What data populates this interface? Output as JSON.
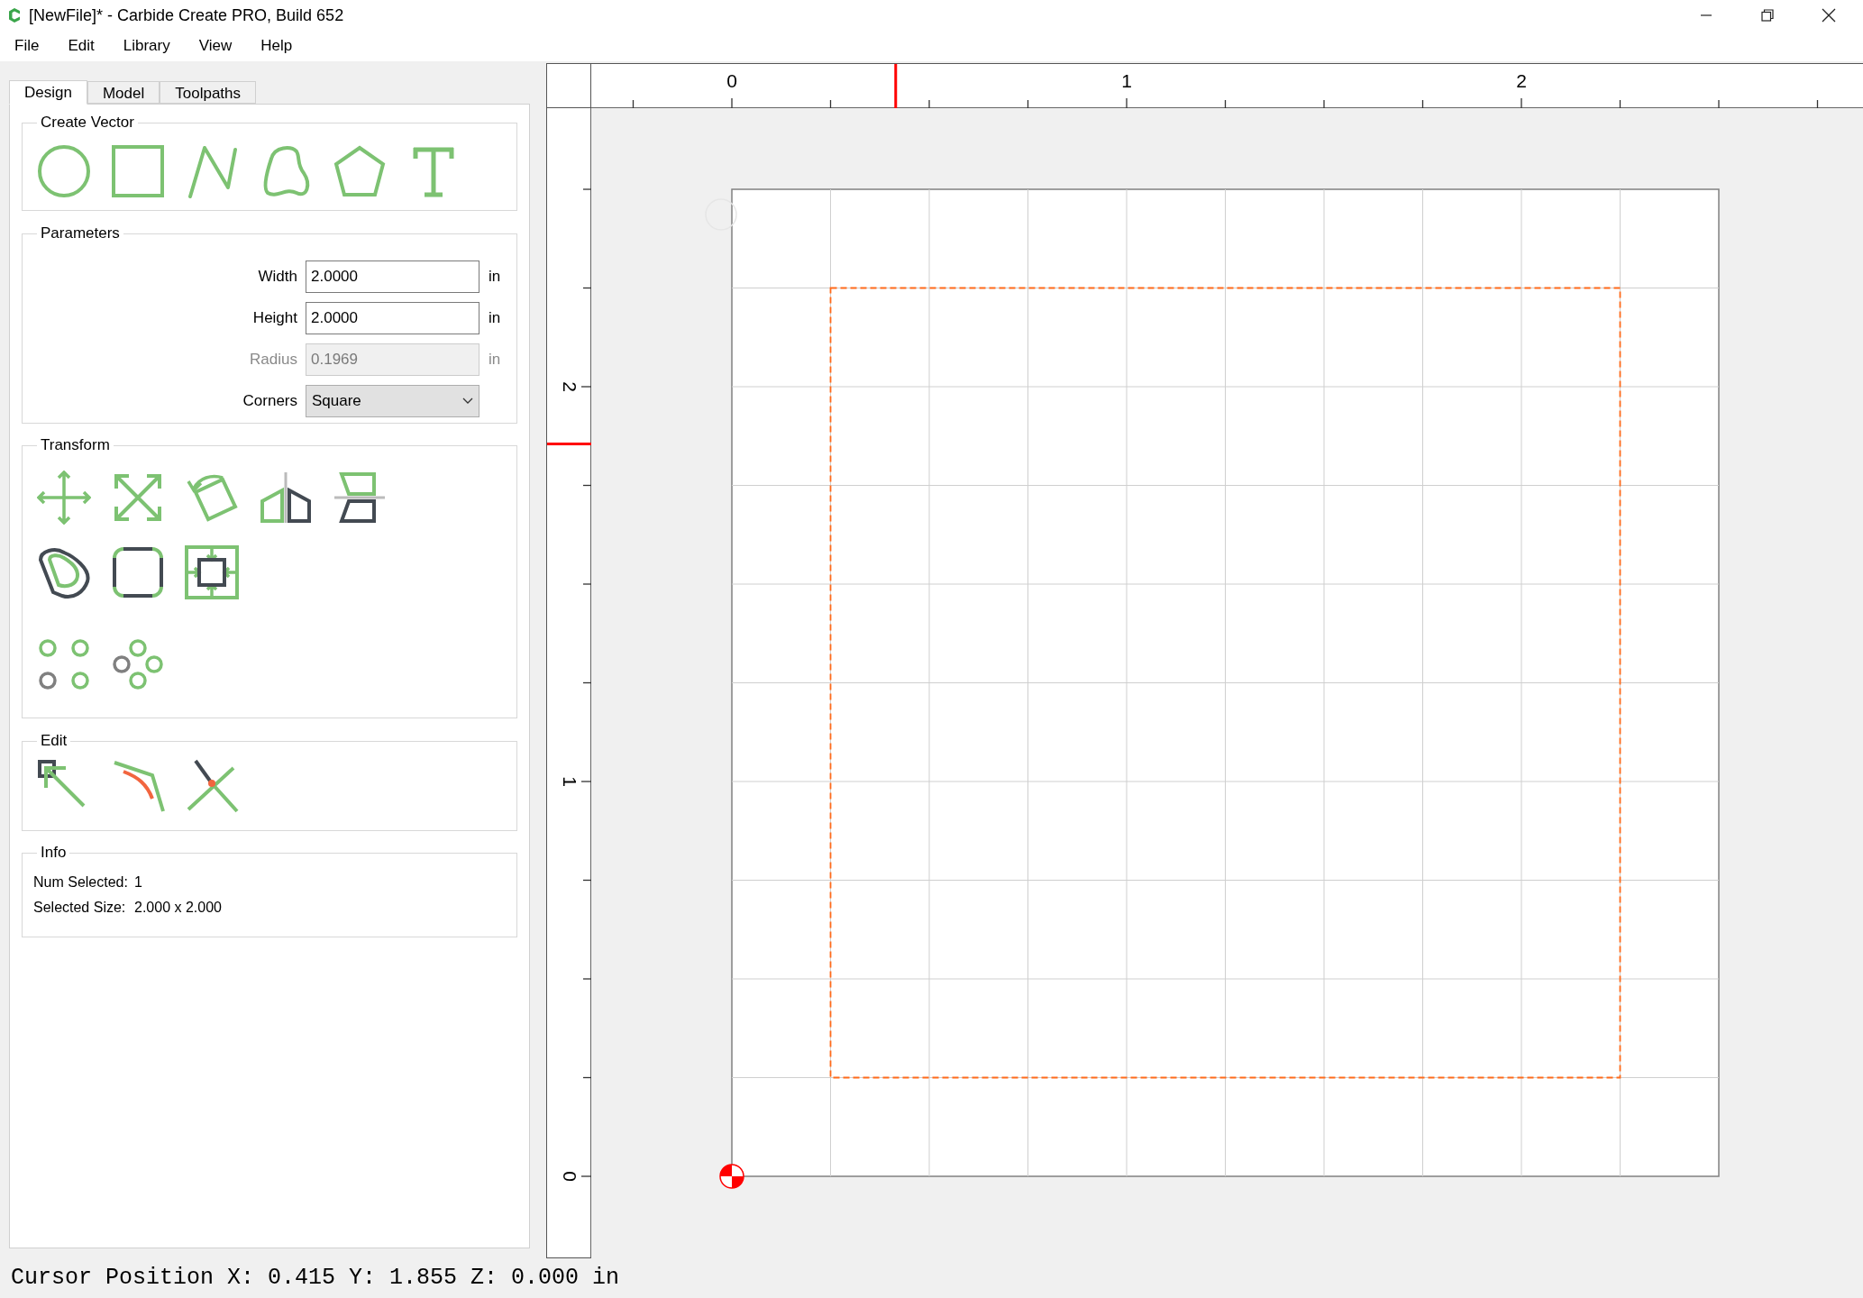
{
  "window": {
    "title": "[NewFile]* - Carbide Create PRO, Build 652"
  },
  "menu": [
    "File",
    "Edit",
    "Library",
    "View",
    "Help"
  ],
  "tabs": [
    {
      "label": "Design",
      "selected": true
    },
    {
      "label": "Model",
      "selected": false
    },
    {
      "label": "Toolpaths",
      "selected": false
    }
  ],
  "create_vector": {
    "title": "Create Vector"
  },
  "parameters": {
    "title": "Parameters",
    "fields": [
      {
        "kind": "text",
        "label": "Width",
        "value": "2.0000",
        "unit": "in",
        "disabled": false
      },
      {
        "kind": "text",
        "label": "Height",
        "value": "2.0000",
        "unit": "in",
        "disabled": false
      },
      {
        "kind": "text",
        "label": "Radius",
        "value": "0.1969",
        "unit": "in",
        "disabled": true
      },
      {
        "kind": "select",
        "label": "Corners",
        "value": "Square"
      }
    ]
  },
  "transform": {
    "title": "Transform"
  },
  "edit": {
    "title": "Edit"
  },
  "info": {
    "title": "Info",
    "rows": [
      {
        "label": "Num Selected:",
        "value": "1"
      },
      {
        "label": "Selected Size:",
        "value": "2.000 x 2.000"
      }
    ]
  },
  "rulers": {
    "top_labels": [
      "0",
      "1",
      "2"
    ],
    "left_labels": [
      "2",
      "1",
      "0"
    ]
  },
  "status_bar": "Cursor Position X: 0.415 Y: 1.855 Z: 0.000 in"
}
